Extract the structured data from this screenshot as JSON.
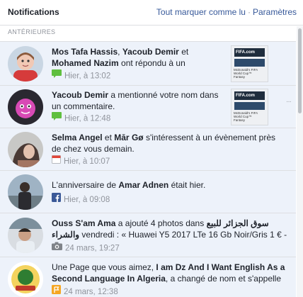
{
  "header": {
    "title": "Notifications",
    "mark_all_read": "Tout marquer comme lu",
    "separator": "·",
    "settings": "Paramètres"
  },
  "section_label": "ANTÉRIEURES",
  "notifications": [
    {
      "name1": "Mos Tafa Hassis",
      "sep1": ", ",
      "name2": "Yacoub Demir",
      "sep2": " et",
      "name3": "Mohamed Nazim",
      "text": " ont répondu à un",
      "time": "Hier, à 13:02",
      "icon": "comment-icon"
    },
    {
      "name1": "Yacoub Demir",
      "text1": " a mentionné votre nom dans",
      "text2": "un commentaire.",
      "time": "Hier, à 12:48",
      "icon": "comment-icon"
    },
    {
      "name1": "Selma Angel",
      "and": " et ",
      "name2": "Mār Gø",
      "text1": " s'intéressent à un évènement près",
      "text2": "de chez vous demain.",
      "time": "Hier, à 10:07",
      "icon": "calendar-icon"
    },
    {
      "text1": "L'anniversaire de ",
      "name1": "Amar Adnen",
      "text2": " était hier.",
      "time": "Hier, à 09:08",
      "icon": "facebook-icon"
    },
    {
      "name1": "Ouss S'am Ama",
      "text1": " a ajouté 4 photos dans ",
      "group_ar1": "سوق الجزائر للبيع",
      "group_ar2": "والشراء",
      "text2": " vendredi : « Huawei Y5 2017 LTe 16 Gb Noir/Gris 1 € -",
      "time": "24 mars, 19:27",
      "icon": "camera-icon"
    },
    {
      "text1": "Une Page que vous aimez, ",
      "name1": "I am Dz And I Want English As a",
      "name2": "Second Language In Algeria",
      "text2": ", a changé de nom et s'appelle",
      "time": "24 mars, 12:38",
      "icon": "flag-icon"
    }
  ],
  "thumbnail_text": {
    "logo": "FIFA.com",
    "caption1": "McDonald's FIFA World Cup™",
    "caption2": "Fantasy"
  },
  "more_options": "···",
  "colors": {
    "link": "#365899",
    "unread_bg": "#edf2fa",
    "meta": "#90949c",
    "comment_icon": "#5fbf3f",
    "facebook_icon": "#3b5998",
    "flag_icon": "#f5a623",
    "calendar_icon": "#e0463a"
  }
}
